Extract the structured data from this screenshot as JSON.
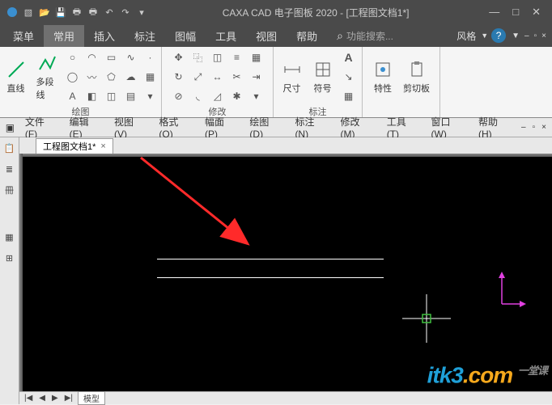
{
  "title": "CAXA CAD 电子图板 2020 - [工程图文档1*]",
  "titlebar_icons": [
    "app",
    "new",
    "open",
    "save",
    "print1",
    "print2",
    "undo",
    "redo",
    "dd"
  ],
  "win_controls": {
    "min": "—",
    "max": "□",
    "close": "✕"
  },
  "menubar": {
    "items": [
      "菜单",
      "常用",
      "插入",
      "标注",
      "图幅",
      "工具",
      "视图",
      "帮助"
    ],
    "active_index": 1,
    "search_icon": "⌕",
    "search_label": "功能搜索...",
    "style_label": "风格",
    "help": "?"
  },
  "ribbon": {
    "panels": [
      {
        "label": "绘图",
        "big": [
          {
            "name": "line",
            "label": "直线"
          },
          {
            "name": "polyline",
            "label": "多段线"
          }
        ]
      },
      {
        "label": "修改",
        "big": []
      },
      {
        "label": "标注",
        "big": [
          {
            "name": "dimension",
            "label": "尺寸"
          },
          {
            "name": "symbol",
            "label": "符号"
          }
        ]
      },
      {
        "label": "",
        "big": [
          {
            "name": "properties",
            "label": "特性"
          },
          {
            "name": "clipboard",
            "label": "剪切板"
          }
        ]
      }
    ]
  },
  "secondmenu": {
    "items": [
      "文件(F)",
      "编辑(E)",
      "视图(V)",
      "格式(O)",
      "幅面(P)",
      "绘图(D)",
      "标注(N)",
      "修改(M)",
      "工具(T)",
      "窗口(W)",
      "帮助(H)"
    ]
  },
  "leftbar": [
    "props",
    "layers",
    "",
    "blocks",
    "xref"
  ],
  "doctab": {
    "label": "工程图文档1*",
    "close": "×"
  },
  "bottombar": {
    "nav": [
      "|◀",
      "◀",
      "▶",
      "▶|"
    ],
    "tab": "模型"
  },
  "canvas": {
    "lines": 2,
    "arrow_color": "#ff2a2a",
    "ucs_color": "#e040e0",
    "cursor_color_h": "#ffffff",
    "cursor_color_box": "#40c040"
  },
  "watermark": {
    "p1": "itk3",
    "p2": ".com",
    "sub": "一堂课"
  }
}
